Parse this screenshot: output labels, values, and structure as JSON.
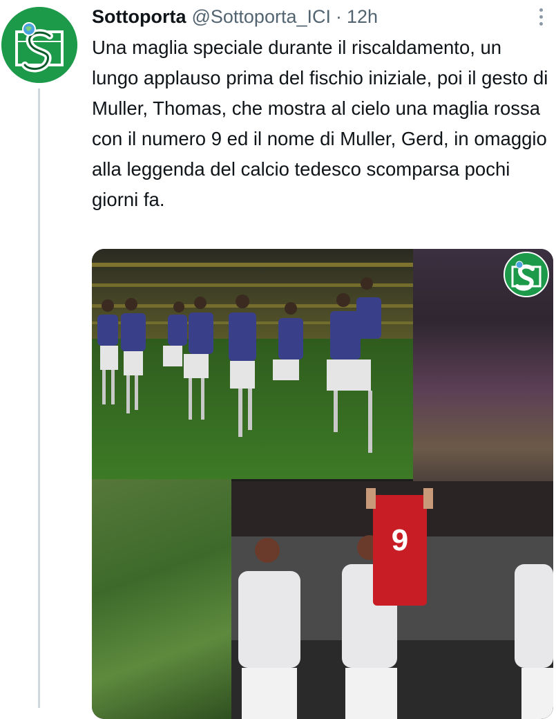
{
  "tweet": {
    "display_name": "Sottoporta",
    "handle": "@Sottoporta_ICI",
    "separator": "·",
    "time": "12h",
    "text": "Una maglia speciale durante il riscaldamento, un lungo applauso prima del fischio iniziale, poi il gesto di Muller, Thomas, che mostra al cielo una maglia rossa con il numero 9 ed il nome di Muller, Gerd, in omaggio alla leggenda del calcio tedesco scomparsa pochi giorni fa."
  },
  "media": {
    "shirt_number": "9"
  },
  "colors": {
    "brand_green": "#1c9a4a",
    "text_primary": "#0f1419",
    "text_secondary": "#536471",
    "thread_line": "#cfd9de"
  },
  "icons": {
    "more": "more-dots-icon",
    "avatar_logo": "sottoporta-logo"
  }
}
